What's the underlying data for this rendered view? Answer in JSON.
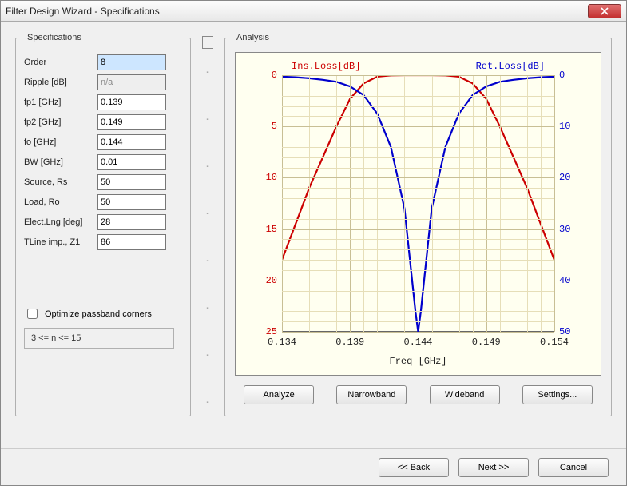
{
  "window": {
    "title": "Filter Design Wizard - Specifications"
  },
  "specs": {
    "legend": "Specifications",
    "fields": {
      "order": {
        "label": "Order",
        "value": "8",
        "disabled": false,
        "selected": true
      },
      "ripple": {
        "label": "Ripple [dB]",
        "value": "n/a",
        "disabled": true
      },
      "fp1": {
        "label": "fp1 [GHz]",
        "value": "0.139",
        "disabled": false
      },
      "fp2": {
        "label": "fp2 [GHz]",
        "value": "0.149",
        "disabled": false
      },
      "fo": {
        "label": "fo [GHz]",
        "value": "0.144",
        "disabled": false
      },
      "bw": {
        "label": "BW [GHz]",
        "value": "0.01",
        "disabled": false
      },
      "source": {
        "label": "Source, Rs",
        "value": "50",
        "disabled": false
      },
      "load": {
        "label": "Load, Ro",
        "value": "50",
        "disabled": false
      },
      "elen": {
        "label": "Elect.Lng [deg]",
        "value": "28",
        "disabled": false
      },
      "z1": {
        "label": "TLine imp., Z1",
        "value": "86",
        "disabled": false
      }
    },
    "optimize_label": "Optimize passband corners",
    "optimize_checked": false,
    "constraint": "3 <= n <= 15"
  },
  "analysis": {
    "legend": "Analysis",
    "buttons": {
      "analyze": "Analyze",
      "narrowband": "Narrowband",
      "wideband": "Wideband",
      "settings": "Settings..."
    }
  },
  "footer": {
    "back": "<< Back",
    "next": "Next >>",
    "cancel": "Cancel"
  },
  "chart_data": {
    "type": "line",
    "xlabel": "Freq [GHz]",
    "x_ticks": [
      0.134,
      0.139,
      0.144,
      0.149,
      0.154
    ],
    "xlim": [
      0.134,
      0.154
    ],
    "y_left": {
      "label": "Ins.Loss[dB]",
      "color": "#cc0000",
      "ticks": [
        0,
        5,
        10,
        15,
        20,
        25
      ],
      "lim": [
        25,
        0
      ]
    },
    "y_right": {
      "label": "Ret.Loss[dB]",
      "color": "#0000cc",
      "ticks": [
        0,
        10,
        20,
        30,
        40,
        50
      ],
      "lim": [
        50,
        0
      ]
    },
    "series": [
      {
        "name": "Ins.Loss[dB]",
        "axis": "left",
        "color": "#cc0000",
        "x": [
          0.134,
          0.135,
          0.136,
          0.137,
          0.138,
          0.139,
          0.14,
          0.141,
          0.142,
          0.143,
          0.144,
          0.145,
          0.146,
          0.147,
          0.148,
          0.149,
          0.15,
          0.151,
          0.152,
          0.153,
          0.154
        ],
        "y": [
          18.0,
          14.5,
          11.0,
          8.0,
          5.0,
          2.3,
          0.8,
          0.15,
          0.02,
          0.0,
          0.0,
          0.0,
          0.02,
          0.15,
          0.8,
          2.3,
          5.0,
          8.0,
          11.0,
          14.5,
          18.0
        ]
      },
      {
        "name": "Ret.Loss[dB]",
        "axis": "right",
        "color": "#0000cc",
        "x": [
          0.134,
          0.135,
          0.136,
          0.137,
          0.138,
          0.139,
          0.14,
          0.141,
          0.142,
          0.143,
          0.1438,
          0.144,
          0.1442,
          0.145,
          0.146,
          0.147,
          0.148,
          0.149,
          0.15,
          0.151,
          0.152,
          0.153,
          0.154
        ],
        "y": [
          0.3,
          0.4,
          0.6,
          0.9,
          1.3,
          2.2,
          3.9,
          7.5,
          14.0,
          26.0,
          46.0,
          50.0,
          46.0,
          26.0,
          14.0,
          7.5,
          3.9,
          2.2,
          1.3,
          0.9,
          0.6,
          0.4,
          0.3
        ]
      }
    ]
  }
}
